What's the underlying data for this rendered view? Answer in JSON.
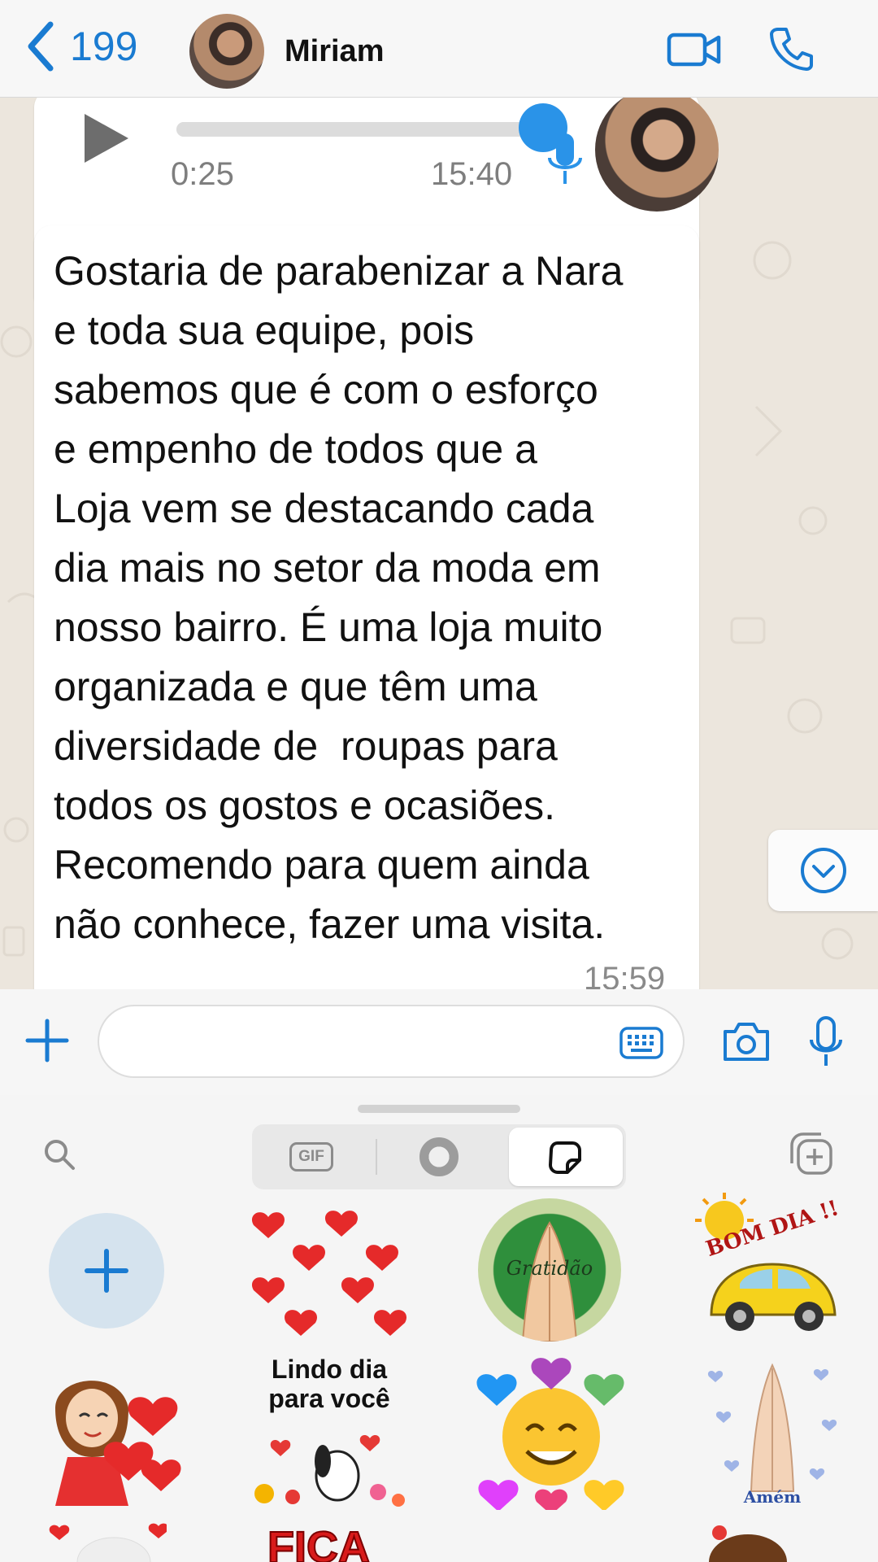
{
  "header": {
    "back_count": "199",
    "contact_name": "Miriam"
  },
  "voice_message": {
    "duration": "0:25",
    "time": "15:40",
    "progress": 0.95
  },
  "text_message": {
    "lines": [
      "Gostaria de parabenizar a Nara",
      "e toda sua equipe, pois",
      "sabemos que é com o esforço",
      "e empenho de todos que a",
      "Loja vem se destacando cada",
      "dia mais no setor da moda em",
      "nosso bairro. É uma loja muito",
      "organizada e que têm uma",
      "diversidade de  roupas para",
      "todos os gostos e ocasiões.",
      "Recomendo para quem ainda",
      "não conhece, fazer uma visita."
    ],
    "time": "15:59"
  },
  "sticker_panel": {
    "tabs": [
      {
        "label": "GIF",
        "icon": "gif-icon"
      },
      {
        "icon": "avatar-icon"
      },
      {
        "icon": "sticker-icon",
        "active": true
      }
    ],
    "stickers": {
      "gratidao": "Gratidão",
      "bom_dia": "BOM DIA !!",
      "lindo_dia_line1": "Lindo dia",
      "lindo_dia_line2": "para você",
      "amem": "Amém",
      "fica": "FICA"
    }
  },
  "colors": {
    "accent_blue": "#1a7bd1",
    "knob_blue": "#2a93e8",
    "chat_bg": "#ece6dd"
  }
}
